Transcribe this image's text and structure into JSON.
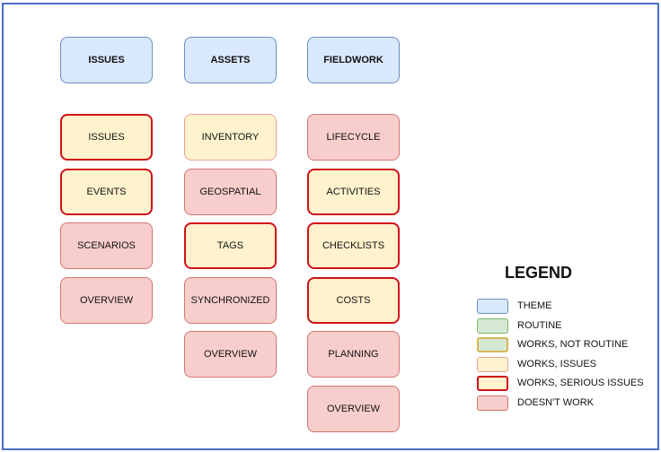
{
  "colors": {
    "theme": {
      "fill": "#dae8fc",
      "stroke": "#6c8ebf",
      "width": 1
    },
    "routine": {
      "fill": "#d5e8d4",
      "stroke": "#82b366",
      "width": 1
    },
    "works_not_routine": {
      "fill": "#d5e8d4",
      "stroke": "#d6b656",
      "width": 2
    },
    "works_issues": {
      "fill": "#fff2cc",
      "stroke": "#e8a09a",
      "width": 1
    },
    "works_serious": {
      "fill": "#fff2cc",
      "stroke": "#d0101a",
      "width": 2
    },
    "doesnt_work": {
      "fill": "#f8cecc",
      "stroke": "#d07670",
      "width": 1
    }
  },
  "columns": [
    {
      "theme": "ISSUES",
      "items": [
        {
          "label": "ISSUES",
          "status": "works_serious"
        },
        {
          "label": "EVENTS",
          "status": "works_serious"
        },
        {
          "label": "SCENARIOS",
          "status": "doesnt_work"
        },
        {
          "label": "OVERVIEW",
          "status": "doesnt_work"
        }
      ]
    },
    {
      "theme": "ASSETS",
      "items": [
        {
          "label": "INVENTORY",
          "status": "works_issues"
        },
        {
          "label": "GEOSPATIAL",
          "status": "doesnt_work"
        },
        {
          "label": "TAGS",
          "status": "works_serious"
        },
        {
          "label": "SYNCHRONIZED",
          "status": "doesnt_work"
        },
        {
          "label": "OVERVIEW",
          "status": "doesnt_work"
        }
      ]
    },
    {
      "theme": "FIELDWORK",
      "items": [
        {
          "label": "LIFECYCLE",
          "status": "doesnt_work"
        },
        {
          "label": "ACTIVITIES",
          "status": "works_serious"
        },
        {
          "label": "CHECKLISTS",
          "status": "works_serious"
        },
        {
          "label": "COSTS",
          "status": "works_serious"
        },
        {
          "label": "PLANNING",
          "status": "doesnt_work"
        },
        {
          "label": "OVERVIEW",
          "status": "doesnt_work"
        }
      ]
    }
  ],
  "legend": {
    "title": "LEGEND",
    "items": [
      {
        "label": "THEME",
        "status": "theme"
      },
      {
        "label": "ROUTINE",
        "status": "routine"
      },
      {
        "label": "WORKS, NOT ROUTINE",
        "status": "works_not_routine"
      },
      {
        "label": "WORKS, ISSUES",
        "status": "works_issues"
      },
      {
        "label": "WORKS, SERIOUS ISSUES",
        "status": "works_serious"
      },
      {
        "label": "DOESN'T WORK",
        "status": "doesnt_work"
      }
    ]
  }
}
